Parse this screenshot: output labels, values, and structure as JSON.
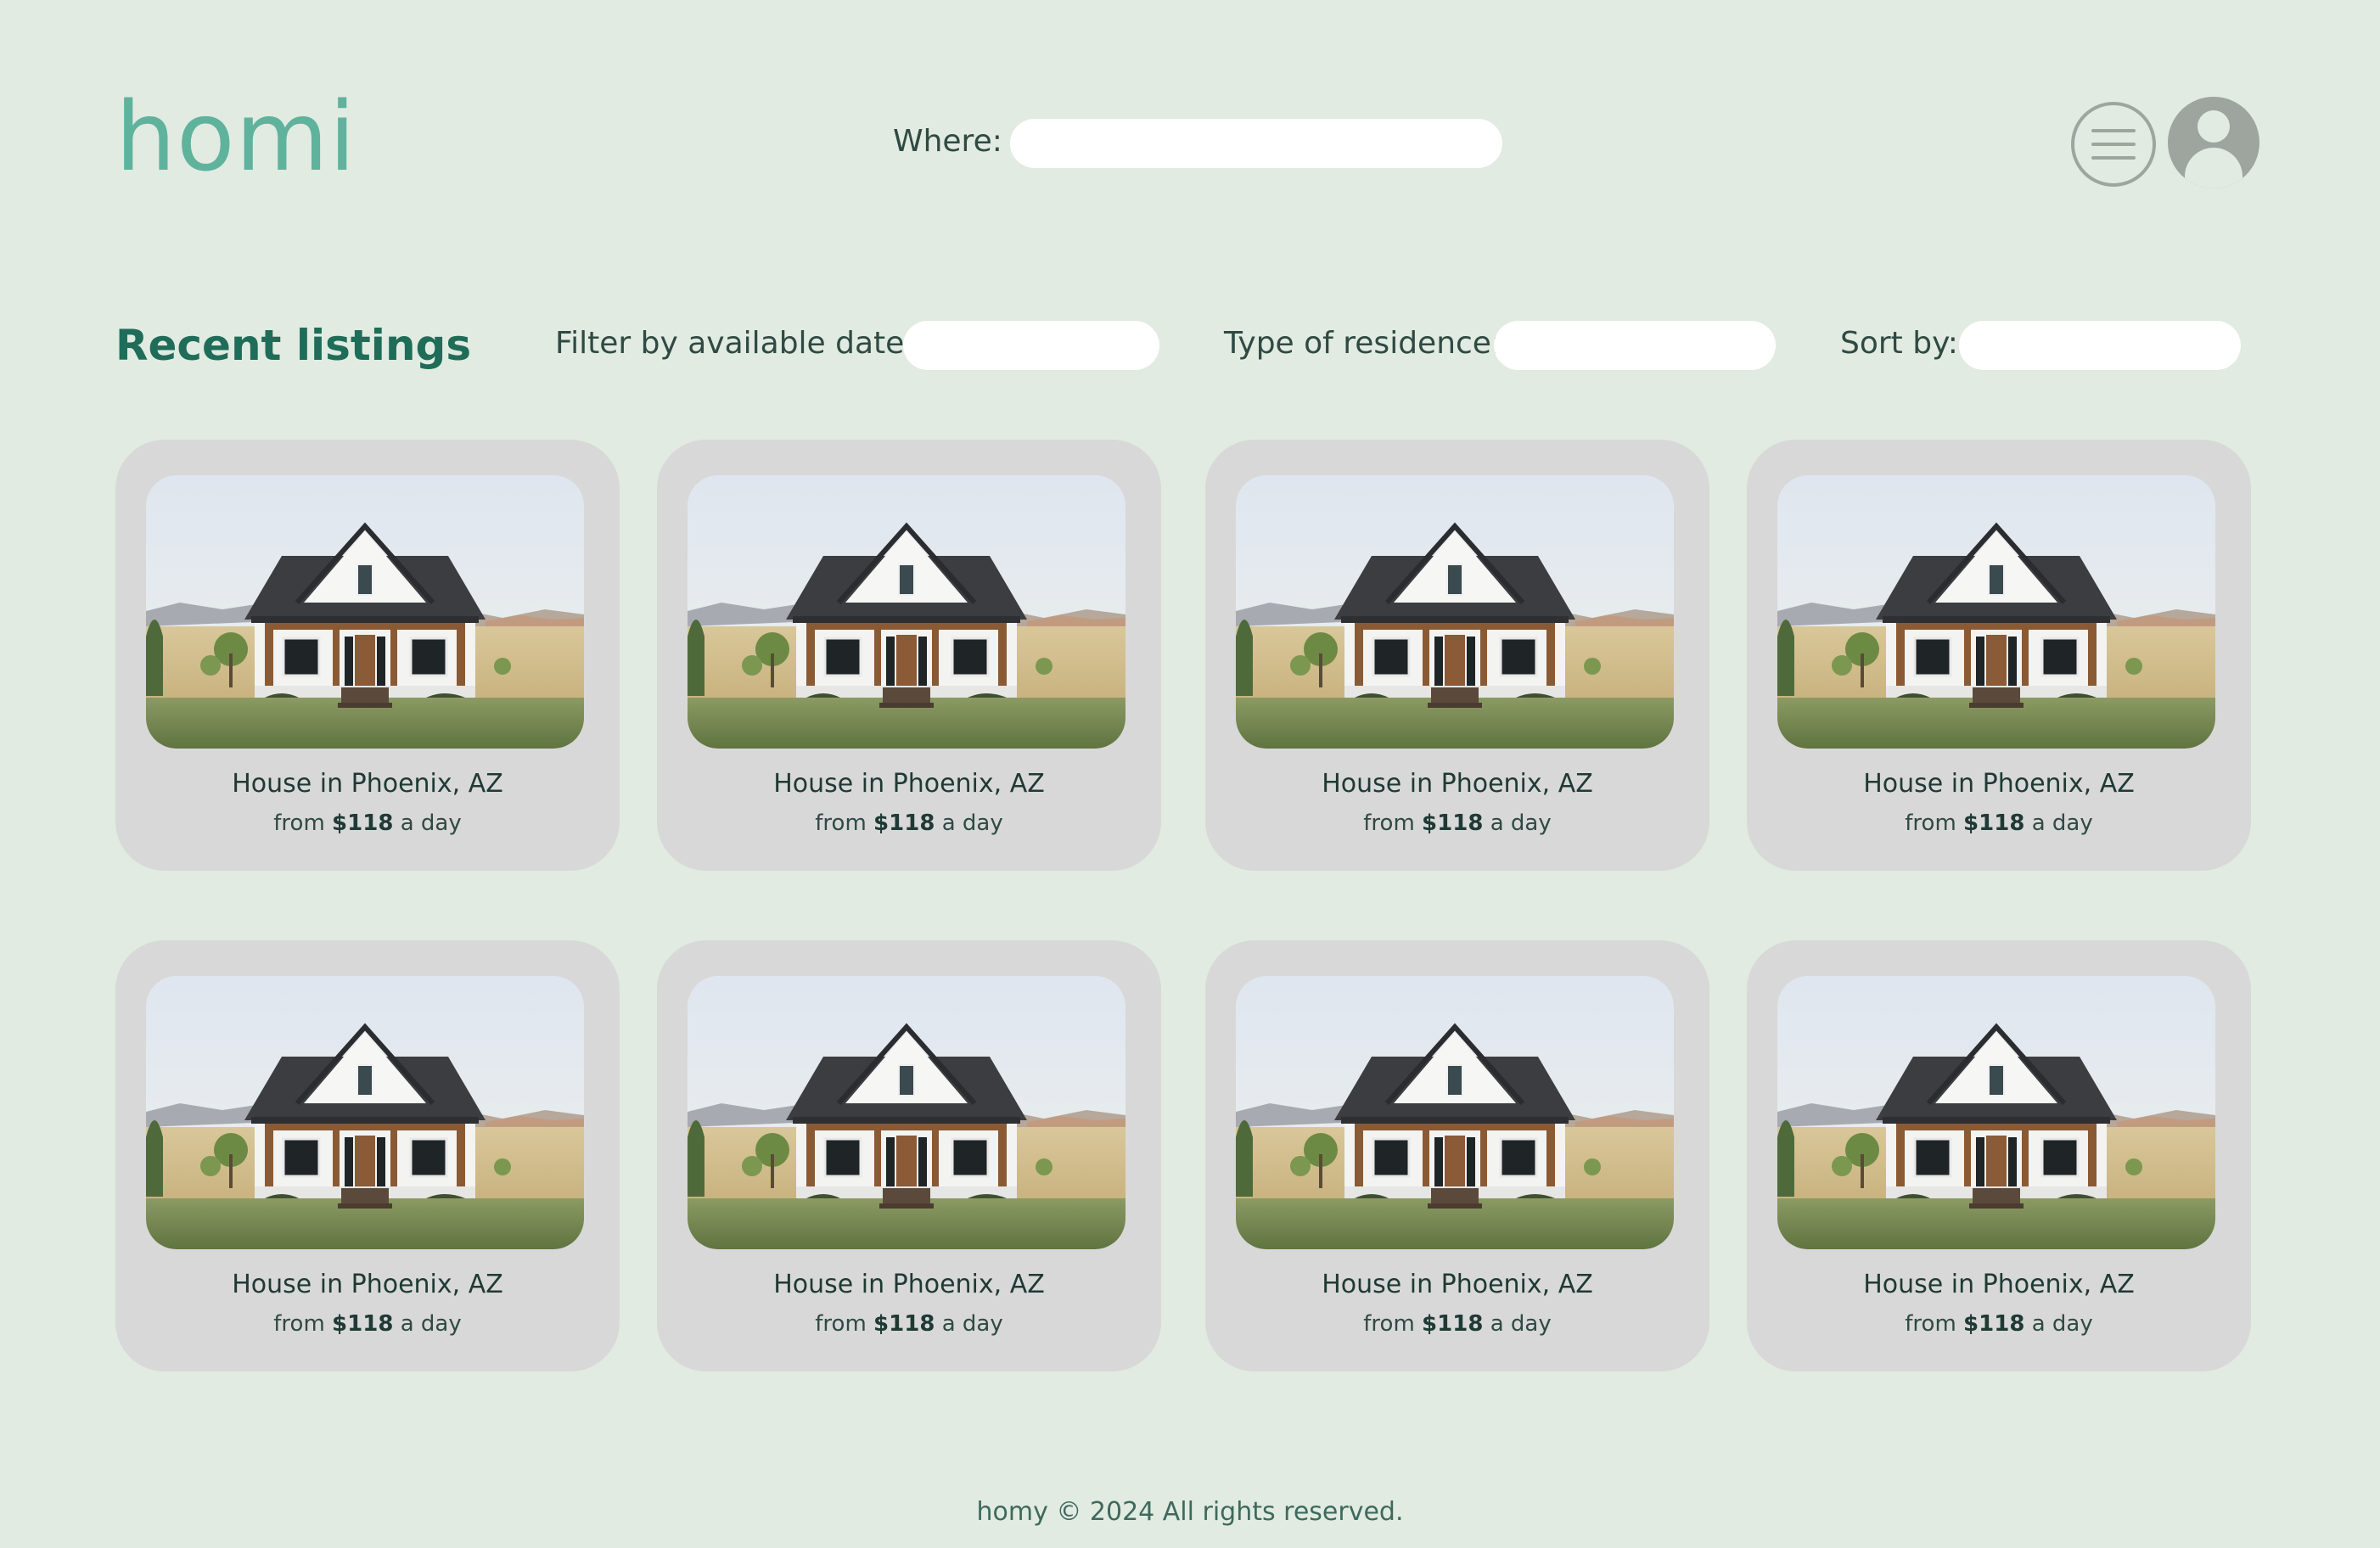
{
  "header": {
    "logo": "homi",
    "where_label": "Where:",
    "where_value": "",
    "menu_icon": "hamburger-menu-icon",
    "avatar_icon": "user-avatar-icon"
  },
  "toolbar": {
    "section_title": "Recent listings",
    "filter_date_label": "Filter by available date:",
    "filter_date_value": "",
    "residence_label": "Type of residence:",
    "residence_value": "",
    "sort_label": "Sort by:",
    "sort_value": ""
  },
  "listings": [
    {
      "title": "House in Phoenix, AZ",
      "price_prefix": "from",
      "price": "$118",
      "price_suffix": "a day"
    },
    {
      "title": "House in Phoenix, AZ",
      "price_prefix": "from",
      "price": "$118",
      "price_suffix": "a day"
    },
    {
      "title": "House in Phoenix, AZ",
      "price_prefix": "from",
      "price": "$118",
      "price_suffix": "a day"
    },
    {
      "title": "House in Phoenix, AZ",
      "price_prefix": "from",
      "price": "$118",
      "price_suffix": "a day"
    },
    {
      "title": "House in Phoenix, AZ",
      "price_prefix": "from",
      "price": "$118",
      "price_suffix": "a day"
    },
    {
      "title": "House in Phoenix, AZ",
      "price_prefix": "from",
      "price": "$118",
      "price_suffix": "a day"
    },
    {
      "title": "House in Phoenix, AZ",
      "price_prefix": "from",
      "price": "$118",
      "price_suffix": "a day"
    },
    {
      "title": "House in Phoenix, AZ",
      "price_prefix": "from",
      "price": "$118",
      "price_suffix": "a day"
    }
  ],
  "footer": {
    "text": "homy © 2024 All rights reserved."
  },
  "colors": {
    "background": "#e1ebe1",
    "brand": "#5fb39c",
    "title": "#1f6d58",
    "card": "#d8d8d8",
    "icon": "#9ea59f"
  }
}
